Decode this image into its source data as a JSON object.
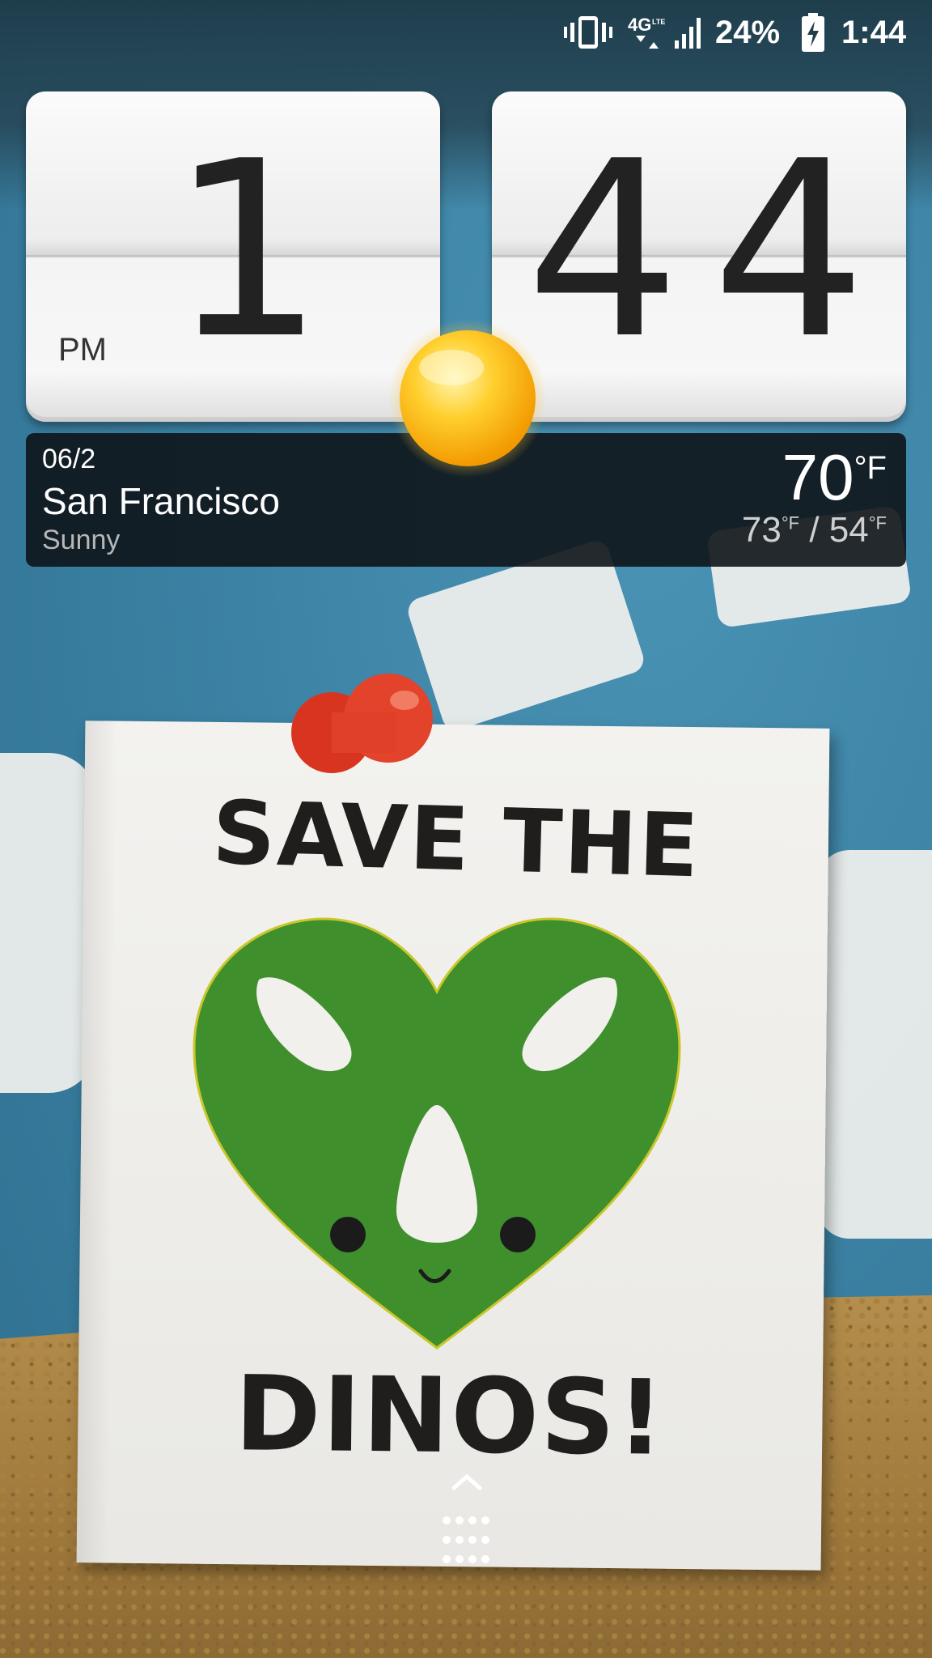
{
  "status_bar": {
    "vibrate_icon": "vibrate-icon",
    "network_label": "4G LTE",
    "signal_icon": "signal-icon",
    "battery_percent": "24%",
    "battery_icon": "battery-charging-icon",
    "time": "1:44"
  },
  "clock": {
    "hour": "1",
    "minute_tens": "4",
    "minute_ones": "4",
    "am_pm": "PM"
  },
  "weather": {
    "date": "06/2",
    "city": "San Francisco",
    "condition": "Sunny",
    "current_temp": "70",
    "current_unit": "°F",
    "high": "73",
    "low": "54",
    "unit": "°F",
    "separator": "/",
    "icon": "sun-icon"
  },
  "wallpaper": {
    "poster_line1": "SAVE THE",
    "poster_line2": "DINOS!",
    "heart_color": "#3f8f2c",
    "pin_color": "#e2432a"
  },
  "app_drawer": {
    "icon": "app-drawer-icon",
    "chevron_icon": "chevron-up-icon"
  }
}
